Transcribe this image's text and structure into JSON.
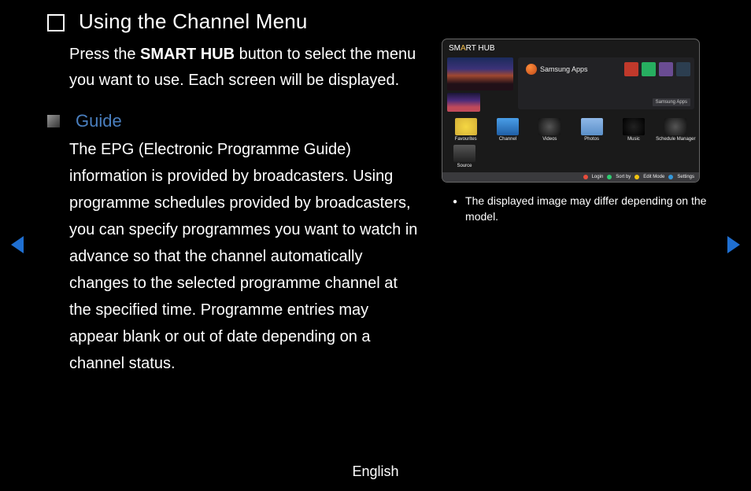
{
  "header": {
    "title": "Using the Channel Menu"
  },
  "intro": {
    "prefix": "Press the ",
    "bold": "SMART HUB",
    "suffix": " button to select the menu you want to use. Each screen will be displayed."
  },
  "section": {
    "title": "Guide",
    "body": "The EPG (Electronic Programme Guide) information is provided by broadcasters. Using programme schedules provided by broadcasters, you can specify programmes you want to watch in advance so that the channel automatically changes to the selected programme channel at the specified time. Programme entries may appear blank or out of date depending on a channel status."
  },
  "tv": {
    "logo_part1": "SM",
    "logo_star": "A",
    "logo_part2": "RT HUB",
    "apps_label": "Samsung Apps",
    "apps_banner": "Samsung Apps",
    "row": [
      "Favourites",
      "Channel",
      "Videos",
      "Photos",
      "Music",
      "Schedule Manager"
    ],
    "row2": [
      "Source"
    ],
    "footer": [
      "Login",
      "Sort by",
      "Edit Mode",
      "Settings"
    ]
  },
  "note": "The displayed image may differ depending on the model.",
  "footer": {
    "language": "English"
  }
}
